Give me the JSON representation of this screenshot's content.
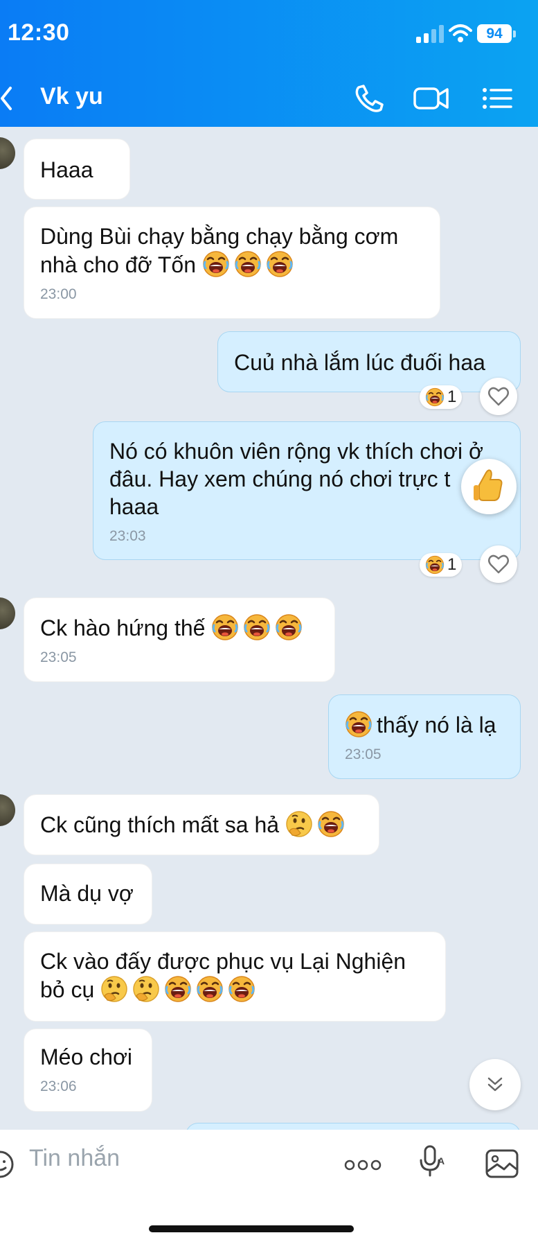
{
  "status_bar": {
    "time": "12:30",
    "battery": "94"
  },
  "header": {
    "contact_name": "Vk yu"
  },
  "messages": [
    {
      "dir": "in",
      "text": "Haaa"
    },
    {
      "dir": "in",
      "text": "Dùng Bùi chạy bằng chạy bằng cơm nhà cho đỡ Tốn",
      "emojis": [
        "laugh-crying",
        "laugh-crying",
        "laugh-crying"
      ],
      "time": "23:00"
    },
    {
      "dir": "out",
      "text": "Cuủ  nhà lắm lúc đuối haa",
      "reaction_count": "1"
    },
    {
      "dir": "out",
      "text": "Nó có khuôn viên rộng vk thích chơi ở đâu. Hay xem chúng nó chơi trực t haaa",
      "time": "23:03",
      "reaction_count": "1"
    },
    {
      "dir": "in",
      "text": "Ck hào hứng thế",
      "emojis": [
        "laugh-crying",
        "laugh-crying",
        "laugh-crying"
      ],
      "time": "23:05"
    },
    {
      "dir": "out",
      "text": "thấy nó là lạ",
      "emojis": [
        "laugh-crying"
      ],
      "time": "23:05"
    },
    {
      "dir": "in",
      "text": "Ck cũng thích mất sa hả",
      "emojis": [
        "thinking",
        "laugh-crying"
      ]
    },
    {
      "dir": "in",
      "text": "Mà dụ vợ"
    },
    {
      "dir": "in",
      "text": "Ck vào đấy được phục vụ Lại Nghiện bỏ cụ",
      "emojis": [
        "thinking",
        "thinking",
        "laugh-crying",
        "laugh-crying",
        "laugh-crying"
      ]
    },
    {
      "dir": "in",
      "text": "Méo chơi",
      "time": "23:06"
    }
  ],
  "composer": {
    "placeholder": "Tin nhắn"
  },
  "colors": {
    "header_start": "#0a7cf5",
    "header_end": "#0ba3f2",
    "chat_bg": "#e2e9f1",
    "outgoing_bubble": "#d5efff",
    "incoming_bubble": "#ffffff"
  },
  "icons": [
    "back-chevron-icon",
    "phone-icon",
    "video-call-icon",
    "menu-list-icon",
    "sticker-icon",
    "more-icon",
    "voice-icon",
    "image-icon",
    "heart-icon",
    "thumbs-up-icon",
    "scroll-down-icon"
  ]
}
